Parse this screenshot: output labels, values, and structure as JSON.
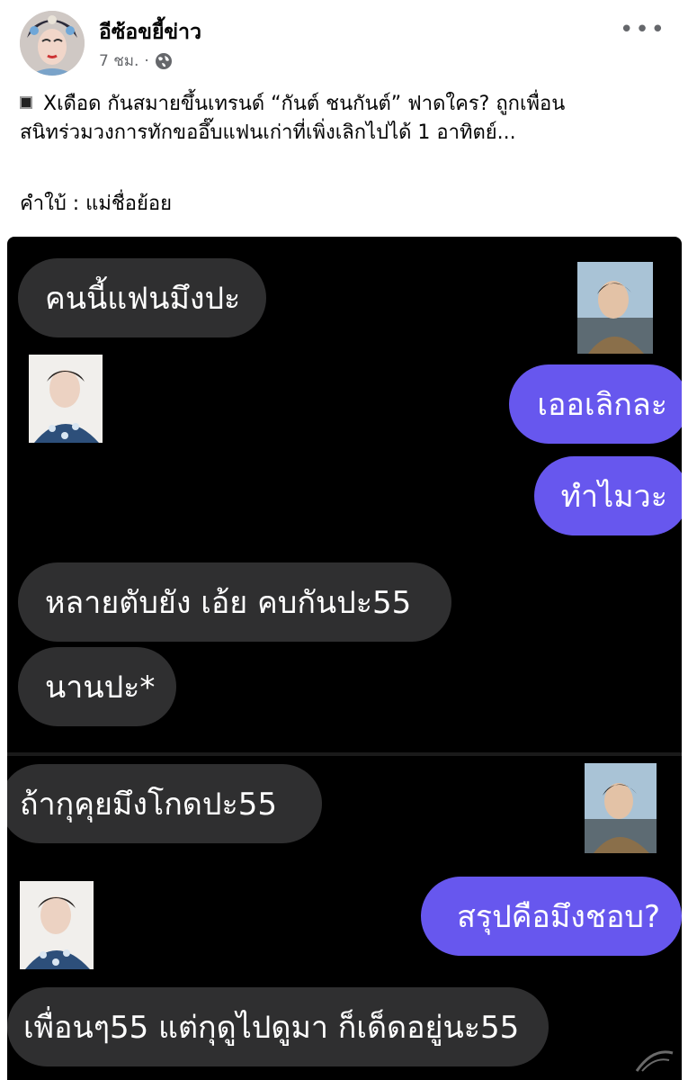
{
  "post": {
    "author": "อีซ้อขยี้ข่าว",
    "time": "7 ชม.",
    "separator": "·",
    "more": "•••",
    "caption_line1": "Xเดือด กันสมายขึ้นเทรนด์ “กันต์ ชนกันต์” ฟาดใคร? ถูกเพื่อน",
    "caption_line2": "สนิทร่วมวงการทักขออึ๊บแฟนเก่าที่เพิ่งเลิกไปได้ 1 อาทิตย์...",
    "subcaption": "คำใบ้ : แม่ชื่อย้อย"
  },
  "chat": {
    "messages": [
      {
        "side": "in",
        "text": "คนนี้แฟนมึงปะ"
      },
      {
        "side": "out",
        "text": "เออเลิกละ"
      },
      {
        "side": "out",
        "text": "ทำไมวะ"
      },
      {
        "side": "in",
        "text": "หลายตับยัง เอ้ย คบกันปะ55"
      },
      {
        "side": "in",
        "text": "นานปะ*"
      },
      {
        "side": "in",
        "text": "ถ้ากุคุยมึงโกดปะ55"
      },
      {
        "side": "out",
        "text": "สรุปคือมึงชอบ?"
      },
      {
        "side": "in",
        "text": "เพื่อนๆ55 แต่กุดูไปดูมา ก็เด็ดอยู่นะ55"
      }
    ],
    "colors": {
      "background": "#000000",
      "incoming": "#2f2f30",
      "outgoing": "#6757ee"
    }
  },
  "icons": {
    "globe": "globe-icon",
    "more": "more-options-icon",
    "bullet": "black-square-icon"
  }
}
